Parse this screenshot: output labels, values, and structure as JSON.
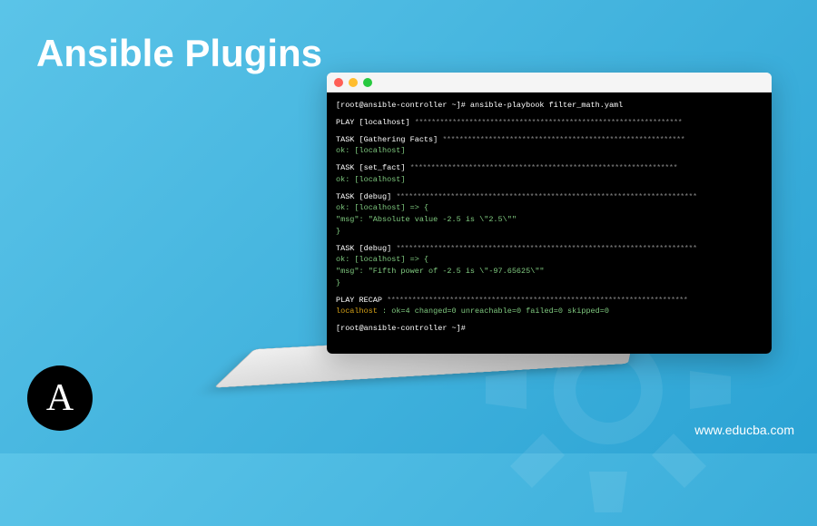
{
  "title": "Ansible Plugins",
  "watermark": "www.educba.com",
  "logo_letter": "A",
  "colors": {
    "bg_primary": "#5bc4e8",
    "bg_secondary": "#2ba3d4",
    "terminal_bg": "#000000",
    "ok_text": "#7fc97f"
  },
  "terminal": {
    "prompt_cmd": "[root@ansible-controller ~]# ansible-playbook filter_math.yaml",
    "play_header": "PLAY [localhost] ",
    "task_gather": "TASK [Gathering Facts] ",
    "ok_localhost": "ok: [localhost]",
    "task_setfact": "TASK [set_fact] ",
    "task_debug": "TASK [debug] ",
    "debug_arrow": "ok: [localhost] => {",
    "msg_abs": "    \"msg\": \"Absolute value -2.5 is \\\"2.5\\\"\"",
    "msg_pow": "    \"msg\": \"Fifth power of -2.5 is \\\"-97.65625\\\"\"",
    "brace_close": "}",
    "recap_header": "PLAY RECAP ",
    "recap_host": "localhost",
    "recap_stats": "            : ok=4    changed=0    unreachable=0    failed=0    skipped=0",
    "final_prompt": "[root@ansible-controller ~]#",
    "stars_long": "****************************************************************",
    "stars_med": "**********************************************************",
    "stars_task": "******************************************************",
    "stars_short": "************************************************************************"
  }
}
